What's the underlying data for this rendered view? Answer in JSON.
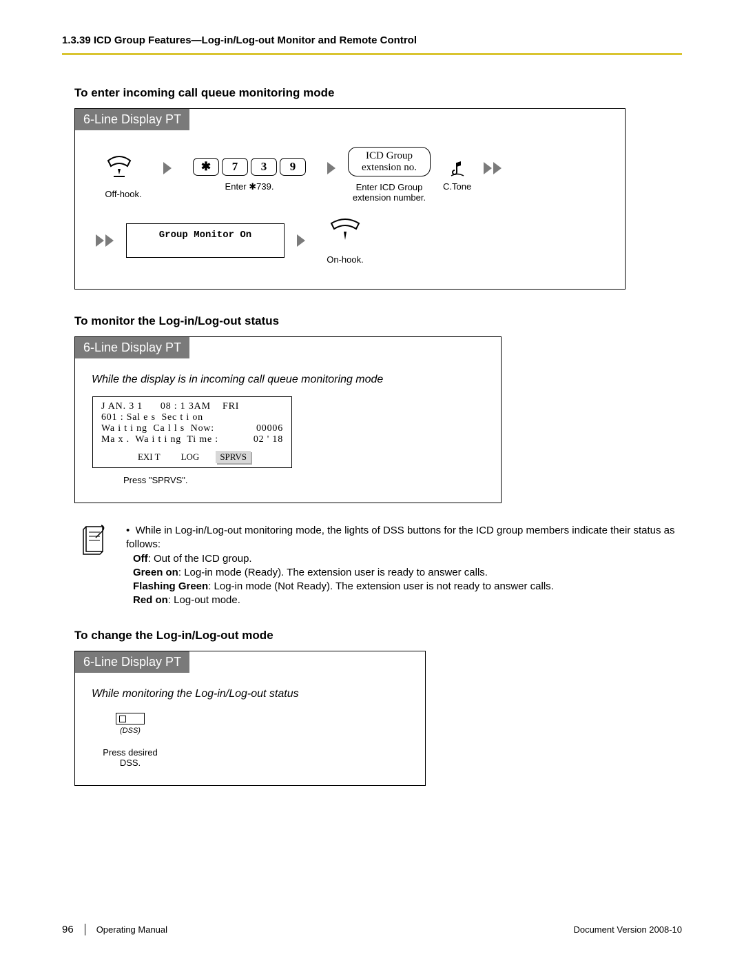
{
  "header": "1.3.39 ICD Group Features—Log-in/Log-out Monitor and Remote Control",
  "section1": {
    "title": "To enter incoming call queue monitoring mode",
    "panel_title": "6-Line Display PT",
    "step_offhook": "Off-hook.",
    "keys": [
      "✱",
      "7",
      "3",
      "9"
    ],
    "step_enter": "Enter ✱739.",
    "icd_box_l1": "ICD Group",
    "icd_box_l2": "extension no.",
    "step_enter_icd_l1": "Enter ICD Group",
    "step_enter_icd_l2": "extension number.",
    "ctone": "C.Tone",
    "display_text": "Group Monitor On",
    "step_onhook": "On-hook."
  },
  "section2": {
    "title": "To monitor the Log-in/Log-out status",
    "panel_title": "6-Line Display PT",
    "subtitle": "While the display is in incoming call queue monitoring mode",
    "lcd": {
      "line1": "J AN. 3 1      08 : 1 3AM    FRI",
      "line2": "601 : Sal e s  Sec t i on",
      "line3_label": "Wa i t i ng  Ca l l s  Now:",
      "line3_val": "00006",
      "line4_label": "Ma x .  Wa i t i ng  Ti me :",
      "line4_val": "02 ' 18",
      "btns": [
        "EXI T",
        "LOG",
        "SPRVS"
      ]
    },
    "press_caption": "Press \"SPRVS\"."
  },
  "notes": {
    "intro": "While in Log-in/Log-out monitoring mode, the lights of DSS buttons for the ICD group members indicate their status as follows:",
    "off_b": "Off",
    "off_t": ": Out of the ICD group.",
    "green_b": "Green on",
    "green_t": ": Log-in mode (Ready). The extension user is ready to answer calls.",
    "flash_b": "Flashing Green",
    "flash_t": ": Log-in mode (Not Ready). The extension user is not ready to answer calls.",
    "red_b": "Red on",
    "red_t": ": Log-out mode."
  },
  "section3": {
    "title": "To change the Log-in/Log-out mode",
    "panel_title": "6-Line Display PT",
    "subtitle": "While monitoring the Log-in/Log-out status",
    "dss_label": "(DSS)",
    "press_caption": "Press desired DSS."
  },
  "footer": {
    "page": "96",
    "manual": "Operating Manual",
    "version": "Document Version  2008-10"
  }
}
